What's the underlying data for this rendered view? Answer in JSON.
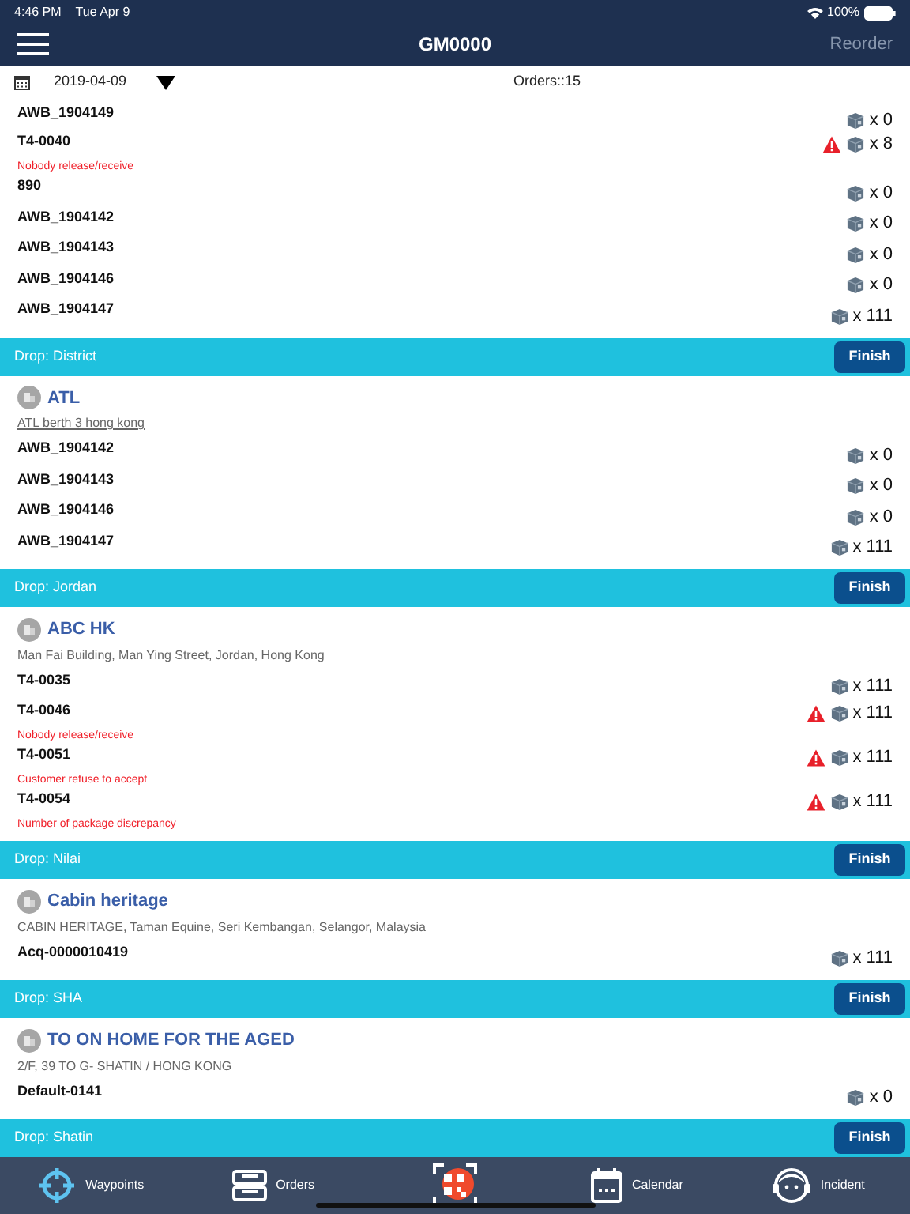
{
  "status_bar": {
    "time": "4:46 PM",
    "date": "Tue Apr 9",
    "battery": "100%"
  },
  "nav": {
    "title": "GM0000",
    "action": "Reorder"
  },
  "filter": {
    "date": "2019-04-09",
    "orders": "Orders::15"
  },
  "sections": [
    {
      "orders": [
        {
          "id": "AWB_1904149",
          "count": "x 0",
          "warning": false
        },
        {
          "id": "T4-0040",
          "issue": "Nobody release/receive",
          "count": "x 8",
          "warning": true
        },
        {
          "id": "890",
          "count": "x 0",
          "warning": false
        },
        {
          "id": "AWB_1904142",
          "count": "x 0",
          "warning": false
        },
        {
          "id": "AWB_1904143",
          "count": "x 0",
          "warning": false
        },
        {
          "id": "AWB_1904146",
          "count": "x 0",
          "warning": false
        },
        {
          "id": "AWB_1904147",
          "count": "x 111",
          "warning": false
        }
      ]
    },
    {
      "drop": "Drop: District",
      "button": "Finish",
      "stop": {
        "name": "ATL",
        "address": "ATL berth 3 hong kong",
        "underlined": true
      },
      "orders": [
        {
          "id": "AWB_1904142",
          "count": "x 0",
          "warning": false
        },
        {
          "id": "AWB_1904143",
          "count": "x 0",
          "warning": false
        },
        {
          "id": "AWB_1904146",
          "count": "x 0",
          "warning": false
        },
        {
          "id": "AWB_1904147",
          "count": "x 111",
          "warning": false
        }
      ]
    },
    {
      "drop": "Drop: Jordan",
      "button": "Finish",
      "stop": {
        "name": "ABC HK",
        "address": "Man Fai Building, Man Ying Street, Jordan, Hong Kong",
        "underlined": false
      },
      "orders": [
        {
          "id": "T4-0035",
          "count": "x 111",
          "warning": false
        },
        {
          "id": "T4-0046",
          "issue": "Nobody release/receive",
          "count": "x 111",
          "warning": true
        },
        {
          "id": "T4-0051",
          "issue": "Customer refuse to accept",
          "count": "x 111",
          "warning": true
        },
        {
          "id": "T4-0054",
          "issue": "Number of package discrepancy",
          "count": "x 111",
          "warning": true
        }
      ]
    },
    {
      "drop": "Drop: Nilai",
      "button": "Finish",
      "stop": {
        "name": "Cabin heritage",
        "address": "CABIN HERITAGE, Taman Equine, Seri Kembangan, Selangor, Malaysia",
        "underlined": false
      },
      "orders": [
        {
          "id": "Acq-0000010419",
          "count": "x 111",
          "warning": false
        }
      ]
    },
    {
      "drop": "Drop: SHA",
      "button": "Finish",
      "stop": {
        "name": "TO ON HOME FOR THE AGED",
        "address": "2/F, 39 TO G- SHATIN / HONG KONG",
        "underlined": false
      },
      "orders": [
        {
          "id": "Default-0141",
          "count": "x 0",
          "warning": false
        }
      ]
    },
    {
      "drop": "Drop: Shatin",
      "button": "Finish"
    }
  ],
  "tabs": [
    {
      "label": "Waypoints",
      "kind": "waypoints",
      "selected": true
    },
    {
      "label": "Orders",
      "kind": "orders",
      "selected": false
    },
    {
      "kind": "scan",
      "selected": false
    },
    {
      "label": "Calendar",
      "kind": "calendar",
      "selected": false
    },
    {
      "label": "Incident",
      "kind": "incident",
      "selected": false
    }
  ]
}
